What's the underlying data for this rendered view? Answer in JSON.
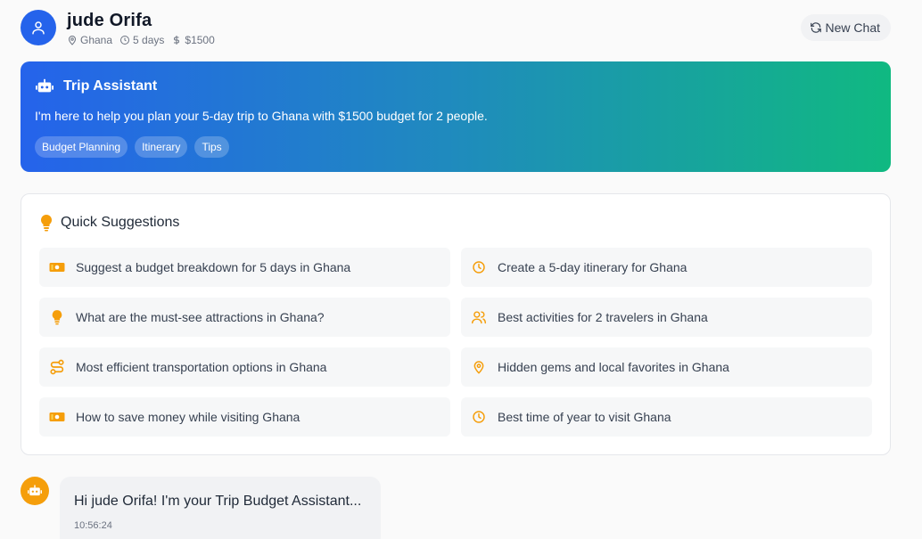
{
  "user": {
    "name": "jude Orifa",
    "country": "Ghana",
    "duration": "5 days",
    "budget": "$1500"
  },
  "header": {
    "new_chat_label": "New Chat"
  },
  "banner": {
    "title": "Trip Assistant",
    "description": "I'm here to help you plan your 5-day trip to Ghana with $1500 budget for 2 people.",
    "chips": [
      "Budget Planning",
      "Itinerary",
      "Tips"
    ]
  },
  "suggestions": {
    "title": "Quick Suggestions",
    "items": [
      {
        "icon": "money-icon",
        "label": "Suggest a budget breakdown for 5 days in Ghana"
      },
      {
        "icon": "clock-icon",
        "label": "Create a 5-day itinerary for Ghana"
      },
      {
        "icon": "lightbulb-icon",
        "label": "What are the must-see attractions in Ghana?"
      },
      {
        "icon": "users-icon",
        "label": "Best activities for 2 travelers in Ghana"
      },
      {
        "icon": "route-icon",
        "label": "Most efficient transportation options in Ghana"
      },
      {
        "icon": "map-pin-icon",
        "label": "Hidden gems and local favorites in Ghana"
      },
      {
        "icon": "money-icon",
        "label": "How to save money while visiting Ghana"
      },
      {
        "icon": "clock-icon",
        "label": "Best time of year to visit Ghana"
      }
    ]
  },
  "chat": {
    "message": "Hi jude Orifa! I'm your Trip Budget Assistant...",
    "time": "10:56:24"
  },
  "colors": {
    "primary": "#2563eb",
    "accent": "#10b981",
    "icon_accent": "#f59e0b"
  }
}
